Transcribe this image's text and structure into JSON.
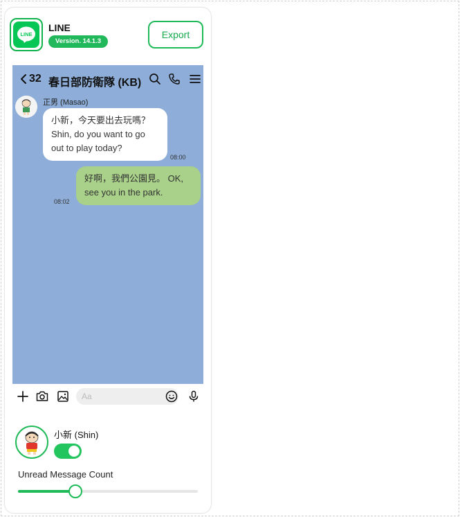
{
  "app": {
    "name": "LINE",
    "version": "Version. 14.1.3",
    "logo_text": "LINE",
    "accent_color": "#06c755"
  },
  "toolbar": {
    "export_label": "Export"
  },
  "chat": {
    "member_count": "32",
    "room_name": "春日部防衛隊 (KB)",
    "background_color": "#8eaed9",
    "messages": [
      {
        "sender": "正男 (Masao)",
        "text": "小新，今天要出去玩嗎？ Shin, do you want to go out to play today?",
        "time": "08:00",
        "direction": "incoming"
      },
      {
        "text": "好啊，我們公園見。 OK, see you in the park.",
        "time": "08:02",
        "direction": "outgoing"
      }
    ],
    "input_placeholder": "Aa"
  },
  "settings": {
    "user_name": "小新 (Shin)",
    "toggle_on": true,
    "slider_label": "Unread Message Count",
    "slider_value_fraction": 0.32
  }
}
